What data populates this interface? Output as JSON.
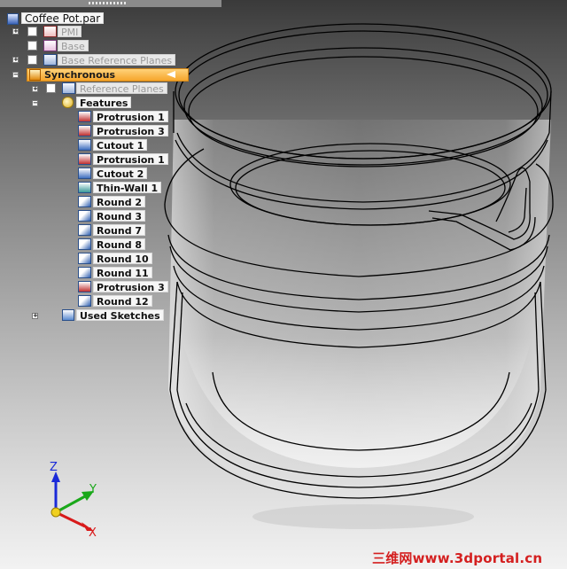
{
  "document": {
    "title": "Coffee Pot.par"
  },
  "tree": {
    "pmi": "PMI",
    "base": "Base",
    "base_reference_planes": "Base Reference Planes",
    "synchronous": "Synchronous",
    "reference_planes": "Reference Planes",
    "features": "Features",
    "feature_items": [
      {
        "label": "Protrusion 1",
        "icon": "protrusion-icon"
      },
      {
        "label": "Protrusion 3",
        "icon": "protrusion-icon"
      },
      {
        "label": "Cutout 1",
        "icon": "cutout-icon"
      },
      {
        "label": "Protrusion 1",
        "icon": "protrusion-icon"
      },
      {
        "label": "Cutout 2",
        "icon": "cutout-icon"
      },
      {
        "label": "Thin-Wall 1",
        "icon": "thin-wall-icon"
      },
      {
        "label": "Round 2",
        "icon": "round-icon"
      },
      {
        "label": "Round 3",
        "icon": "round-icon"
      },
      {
        "label": "Round 7",
        "icon": "round-icon"
      },
      {
        "label": "Round 8",
        "icon": "round-icon"
      },
      {
        "label": "Round 10",
        "icon": "round-icon"
      },
      {
        "label": "Round 11",
        "icon": "round-icon"
      },
      {
        "label": "Protrusion 3",
        "icon": "protrusion-icon"
      },
      {
        "label": "Round 12",
        "icon": "round-icon"
      }
    ],
    "used_sketches": "Used Sketches"
  },
  "triad": {
    "z": "Z",
    "y": "Y",
    "x": "X"
  },
  "colors": {
    "synchronous_highlight": "#f6a52b",
    "axis_z": "#1a2ad8",
    "axis_y": "#1aa81a",
    "axis_x": "#d81a1a",
    "watermark": "#d42020"
  },
  "watermark": "三维网www.3dportal.cn"
}
